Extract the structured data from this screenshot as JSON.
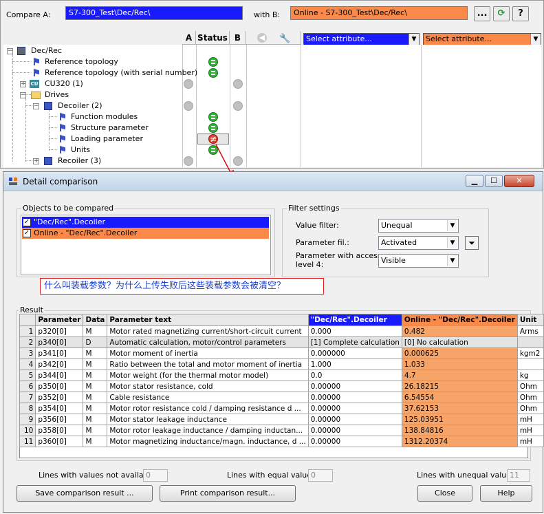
{
  "top": {
    "compare_a_label": "Compare A:",
    "compare_a_value": "S7-300_Test\\Dec/Rec\\",
    "compare_a_color": "#1a1aff",
    "with_b_label": "with B:",
    "with_b_value": "Online - S7-300_Test\\Dec/Rec\\",
    "with_b_color": "#fb8a4a",
    "browse_label": "...",
    "col_a": "A",
    "col_status": "Status",
    "col_b": "B",
    "select_attr_a": "Select attribute...",
    "select_attr_b": "Select attribute...",
    "tree": [
      {
        "label": "Dec/Rec",
        "status": "none"
      },
      {
        "label": "Reference topology",
        "status": "equal"
      },
      {
        "label": "Reference topology (with serial number)",
        "status": "equal"
      },
      {
        "label": "CU320 (1)",
        "status": "none"
      },
      {
        "label": "Drives",
        "status": "none"
      },
      {
        "label": "Decoiler (2)",
        "status": "none"
      },
      {
        "label": "Function modules",
        "status": "equal"
      },
      {
        "label": "Structure parameter",
        "status": "equal"
      },
      {
        "label": "Loading parameter",
        "status": "unequal"
      },
      {
        "label": "Units",
        "status": "equal"
      },
      {
        "label": "Recoiler (3)",
        "status": "none"
      }
    ]
  },
  "dialog": {
    "title": "Detail comparison",
    "objects_group": "Objects to be compared",
    "objects": [
      {
        "label": "\"Dec/Rec\".Decoiler",
        "checked": true,
        "color": "#1a1aff"
      },
      {
        "label": "Online - \"Dec/Rec\".Decoiler",
        "checked": true,
        "color": "#fb8a4a"
      }
    ],
    "filter_group": "Filter settings",
    "value_filter_label": "Value filter:",
    "value_filter_value": "Unequal",
    "param_filter_label": "Parameter fil.:",
    "param_filter_value": "Activated",
    "access_label_1": "Parameter with access",
    "access_label_2": "level 4:",
    "access_value": "Visible",
    "annotation": "什么叫装载参数？为什么上传失败后这些装载参数会被清空？",
    "result_group": "Result",
    "columns": [
      "",
      "Parameter",
      "Data",
      "Parameter text",
      "\"Dec/Rec\".Decoiler",
      "Online - \"Dec/Rec\".Decoiler",
      "Unit"
    ],
    "rows": [
      [
        "1",
        "p320[0]",
        "M",
        "Motor rated magnetizing current/short-circuit current",
        "0.000",
        "0.482",
        "Arms"
      ],
      [
        "2",
        "p340[0]",
        "D",
        "Automatic calculation, motor/control parameters",
        "[1] Complete calculation",
        "[0] No calculation",
        ""
      ],
      [
        "3",
        "p341[0]",
        "M",
        "Motor moment of inertia",
        "0.000000",
        "0.000625",
        "kgm2"
      ],
      [
        "4",
        "p342[0]",
        "M",
        "Ratio between the total and motor moment of inertia",
        "1.000",
        "1.033",
        ""
      ],
      [
        "5",
        "p344[0]",
        "M",
        "Motor weight (for the thermal motor model)",
        "0.0",
        "4.7",
        "kg"
      ],
      [
        "6",
        "p350[0]",
        "M",
        "Motor stator resistance, cold",
        "0.00000",
        "26.18215",
        "Ohm"
      ],
      [
        "7",
        "p352[0]",
        "M",
        "Cable resistance",
        "0.00000",
        "6.54554",
        "Ohm"
      ],
      [
        "8",
        "p354[0]",
        "M",
        "Motor rotor resistance cold / damping resistance d ...",
        "0.00000",
        "37.62153",
        "Ohm"
      ],
      [
        "9",
        "p356[0]",
        "M",
        "Motor stator leakage inductance",
        "0.00000",
        "125.03951",
        "mH"
      ],
      [
        "10",
        "p358[0]",
        "M",
        "Motor rotor leakage inductance / damping inductan...",
        "0.00000",
        "138.84816",
        "mH"
      ],
      [
        "11",
        "p360[0]",
        "M",
        "Motor magnetizing inductance/magn. inductance, d ...",
        "0.00000",
        "1312.20374",
        "mH"
      ]
    ],
    "not_available_label": "Lines with values not available:",
    "not_available_value": "0",
    "equal_label": "Lines with equal values:",
    "equal_value": "0",
    "unequal_label": "Lines with unequal values:",
    "unequal_value": "11",
    "save_button": "Save comparison result ...",
    "print_button": "Print comparison result...",
    "close_button": "Close",
    "help_button": "Help"
  }
}
